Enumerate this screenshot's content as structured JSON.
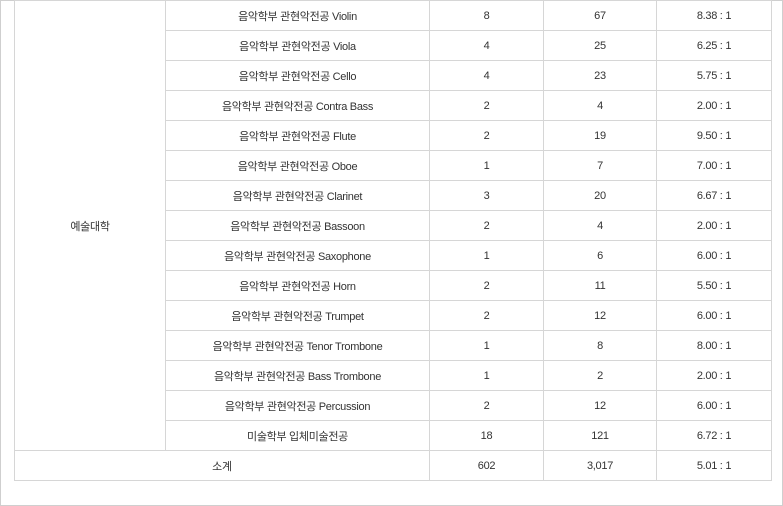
{
  "table": {
    "college": "예술대학",
    "rows": [
      {
        "department": "음악학부 관현악전공 Violin",
        "quota": "8",
        "applicants": "67",
        "ratio": "8.38 : 1"
      },
      {
        "department": "음악학부 관현악전공 Viola",
        "quota": "4",
        "applicants": "25",
        "ratio": "6.25 : 1"
      },
      {
        "department": "음악학부 관현악전공 Cello",
        "quota": "4",
        "applicants": "23",
        "ratio": "5.75 : 1"
      },
      {
        "department": "음악학부 관현악전공 Contra Bass",
        "quota": "2",
        "applicants": "4",
        "ratio": "2.00 : 1"
      },
      {
        "department": "음악학부 관현악전공 Flute",
        "quota": "2",
        "applicants": "19",
        "ratio": "9.50 : 1"
      },
      {
        "department": "음악학부 관현악전공 Oboe",
        "quota": "1",
        "applicants": "7",
        "ratio": "7.00 : 1"
      },
      {
        "department": "음악학부 관현악전공 Clarinet",
        "quota": "3",
        "applicants": "20",
        "ratio": "6.67 : 1"
      },
      {
        "department": "음악학부 관현악전공 Bassoon",
        "quota": "2",
        "applicants": "4",
        "ratio": "2.00 : 1"
      },
      {
        "department": "음악학부 관현악전공 Saxophone",
        "quota": "1",
        "applicants": "6",
        "ratio": "6.00 : 1"
      },
      {
        "department": "음악학부 관현악전공 Horn",
        "quota": "2",
        "applicants": "11",
        "ratio": "5.50 : 1"
      },
      {
        "department": "음악학부 관현악전공 Trumpet",
        "quota": "2",
        "applicants": "12",
        "ratio": "6.00 : 1"
      },
      {
        "department": "음악학부 관현악전공 Tenor Trombone",
        "quota": "1",
        "applicants": "8",
        "ratio": "8.00 : 1"
      },
      {
        "department": "음악학부 관현악전공 Bass Trombone",
        "quota": "1",
        "applicants": "2",
        "ratio": "2.00 : 1"
      },
      {
        "department": "음악학부 관현악전공 Percussion",
        "quota": "2",
        "applicants": "12",
        "ratio": "6.00 : 1"
      },
      {
        "department": "미술학부 입체미술전공",
        "quota": "18",
        "applicants": "121",
        "ratio": "6.72 : 1"
      }
    ],
    "subtotal": {
      "label": "소계",
      "quota": "602",
      "applicants": "3,017",
      "ratio": "5.01 : 1"
    }
  },
  "colors": {
    "border": "#d6d6d6",
    "frame": "#cfcfcf",
    "text": "#333333"
  }
}
